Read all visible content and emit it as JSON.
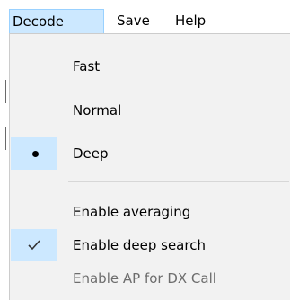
{
  "menubar": {
    "items": [
      {
        "label": "Decode"
      },
      {
        "label": "Save"
      },
      {
        "label": "Help"
      }
    ]
  },
  "decode_menu": {
    "items": [
      {
        "label": "Fast",
        "state": "unchecked",
        "enabled": true
      },
      {
        "label": "Normal",
        "state": "unchecked",
        "enabled": true
      },
      {
        "label": "Deep",
        "state": "radio-selected",
        "enabled": true
      },
      {
        "label": "Enable averaging",
        "state": "unchecked",
        "enabled": true
      },
      {
        "label": "Enable deep search",
        "state": "checked",
        "enabled": true
      },
      {
        "label": "Enable AP for DX Call",
        "state": "unchecked",
        "enabled": false
      }
    ]
  },
  "colors": {
    "highlight": "#cce8ff",
    "highlight_border": "#99d1ff",
    "menu_background": "#f2f2f2",
    "disabled_text": "#6d6d6d"
  }
}
